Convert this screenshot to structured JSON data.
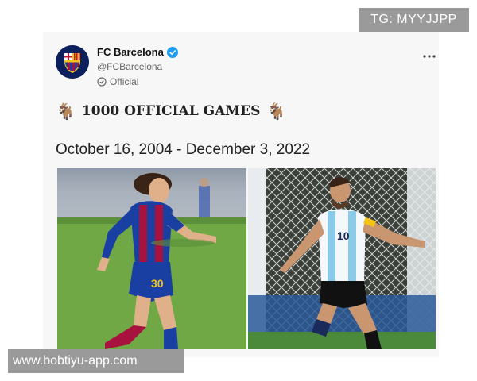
{
  "watermarks": {
    "top": "TG: MYYJJPP",
    "bottom": "www.bobtiyu-app.com"
  },
  "tweet": {
    "author_name": "FC Barcelona",
    "handle": "@FCBarcelona",
    "label": "Official",
    "more_icon": "more-horizontal-icon",
    "headline": "1000 OFFICIAL GAMES",
    "emoji": "🐐",
    "dates": "October 16, 2004 - December 3, 2022",
    "left_jersey_number": "30",
    "right_jersey_number": "10"
  },
  "colors": {
    "verified": "#1d9bf0",
    "barca_blue": "#1a3fa3",
    "barca_red": "#a8123e",
    "pitch_green": "#6fa844",
    "argentina_sky": "#8ccbe8"
  }
}
